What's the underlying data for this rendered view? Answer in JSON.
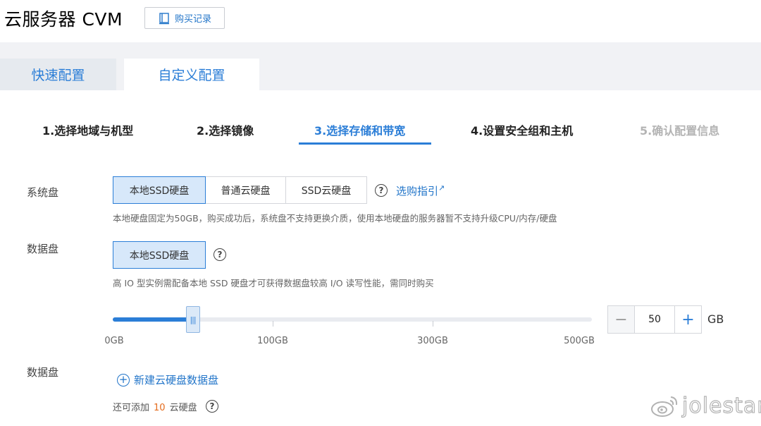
{
  "header": {
    "title": "云服务器 CVM",
    "history_button": "购买记录"
  },
  "tabs": [
    {
      "label": "快速配置"
    },
    {
      "label": "自定义配置",
      "active": true
    }
  ],
  "steps": [
    {
      "label": "1.选择地域与机型"
    },
    {
      "label": "2.选择镜像"
    },
    {
      "label": "3.选择存储和带宽",
      "active": true
    },
    {
      "label": "4.设置安全组和主机"
    },
    {
      "label": "5.确认配置信息",
      "disabled": true
    }
  ],
  "system_disk": {
    "label": "系统盘",
    "options": [
      "本地SSD硬盘",
      "普通云硬盘",
      "SSD云硬盘"
    ],
    "selected": "本地SSD硬盘",
    "guide_link": "选购指引",
    "note": "本地硬盘固定为50GB，购买成功后，系统盘不支持更换介质，使用本地硬盘的服务器暂不支持升级CPU/内存/硬盘"
  },
  "data_disk": {
    "label": "数据盘",
    "option": "本地SSD硬盘",
    "note": "高 IO 型实例需配备本地 SSD 硬盘才可获得数据盘较高 I/O 读写性能，需同时购买",
    "slider": {
      "value": 50,
      "min": 0,
      "max": 500,
      "tick_labels": [
        "0GB",
        "100GB",
        "300GB",
        "500GB"
      ]
    },
    "stepper": {
      "minus": "−",
      "value": "50",
      "plus": "+"
    },
    "unit": "GB"
  },
  "cloud_data_disk": {
    "label": "数据盘",
    "add_link": "新建云硬盘数据盘",
    "remain_prefix": "还可添加",
    "remain_count": "10",
    "remain_suffix": "云硬盘"
  },
  "watermark": {
    "text": "jolestar"
  },
  "colors": {
    "accent": "#2b7ed7",
    "link": "#2275c9",
    "count": "#e46b1c",
    "selected_bg": "#d7e8fa"
  },
  "icons": {
    "history": "book-icon",
    "help": "question-circle-icon",
    "external": "external-link-icon",
    "add": "plus-circle-icon"
  }
}
